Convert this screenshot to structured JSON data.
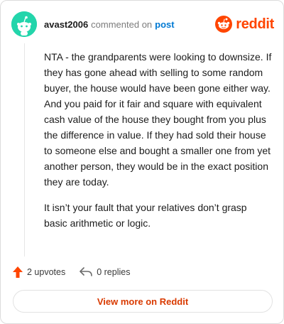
{
  "header": {
    "username": "avast2006",
    "commented_text": "commented on",
    "post_link": "post",
    "brand": "reddit"
  },
  "comment": {
    "paragraphs": [
      "NTA - the grandparents were looking to downsize. If they has gone ahead with selling to some random buyer, the house would have been gone either way. And you paid for it fair and square with equivalent cash value of the house they bought from you plus the difference in value. If they had sold their house to someone else and bought a smaller one from yet another person, they would be in the exact position they are today.",
      "It isn’t your fault that your relatives don’t grasp basic arithmetic or logic."
    ]
  },
  "actions": {
    "upvotes": "2 upvotes",
    "replies": "0 replies"
  },
  "footer": {
    "view_label": "View more on Reddit"
  },
  "colors": {
    "avatar_bg": "#23d5ab",
    "brand_orange": "#ff4500",
    "upvote_orange": "#ff4500",
    "link_blue": "#0079d3",
    "button_text": "#d93a00"
  },
  "icons": {
    "avatar": "reddit-snoo-avatar-icon",
    "brand": "reddit-logo-icon",
    "upvote": "upvote-arrow-icon",
    "reply": "reply-arrow-icon"
  }
}
